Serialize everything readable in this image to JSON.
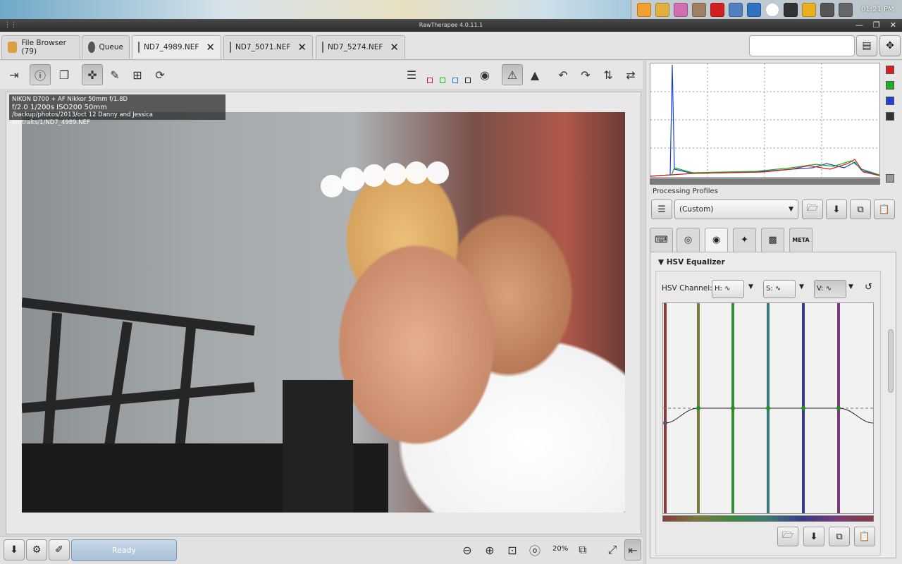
{
  "desktop": {
    "clock": "01:21 PM"
  },
  "window": {
    "title": "RawTherapee 4.0.11.1"
  },
  "tabs": [
    {
      "label": "File Browser (79)"
    },
    {
      "label": "Queue"
    },
    {
      "label": "ND7_4989.NEF"
    },
    {
      "label": "ND7_5071.NEF"
    },
    {
      "label": "ND7_5274.NEF"
    }
  ],
  "image_info": {
    "line1": "NIKON D700 + AF Nikkor 50mm f/1.8D",
    "line2": "f/2.0  1/200s  ISO200  50mm",
    "line3": "/backup/photos/2013/oct 12 Danny and Jessica portraits/1/ND7_4989.NEF"
  },
  "bottom": {
    "status": "Ready",
    "zoom": "20%"
  },
  "processing_profiles": {
    "label": "Processing Profiles",
    "selected": "(Custom)"
  },
  "tool_tabs": [
    {
      "label": "META"
    }
  ],
  "hsv": {
    "title": "HSV Equalizer",
    "channel_label": "HSV Channel:",
    "h": "H:",
    "s": "S:",
    "v": "V:"
  },
  "colors": {
    "status_bg": "#a8bfd6",
    "accent_red": "#d21f1f",
    "accent_green": "#1fae1f",
    "accent_blue": "#1f3fd2"
  }
}
